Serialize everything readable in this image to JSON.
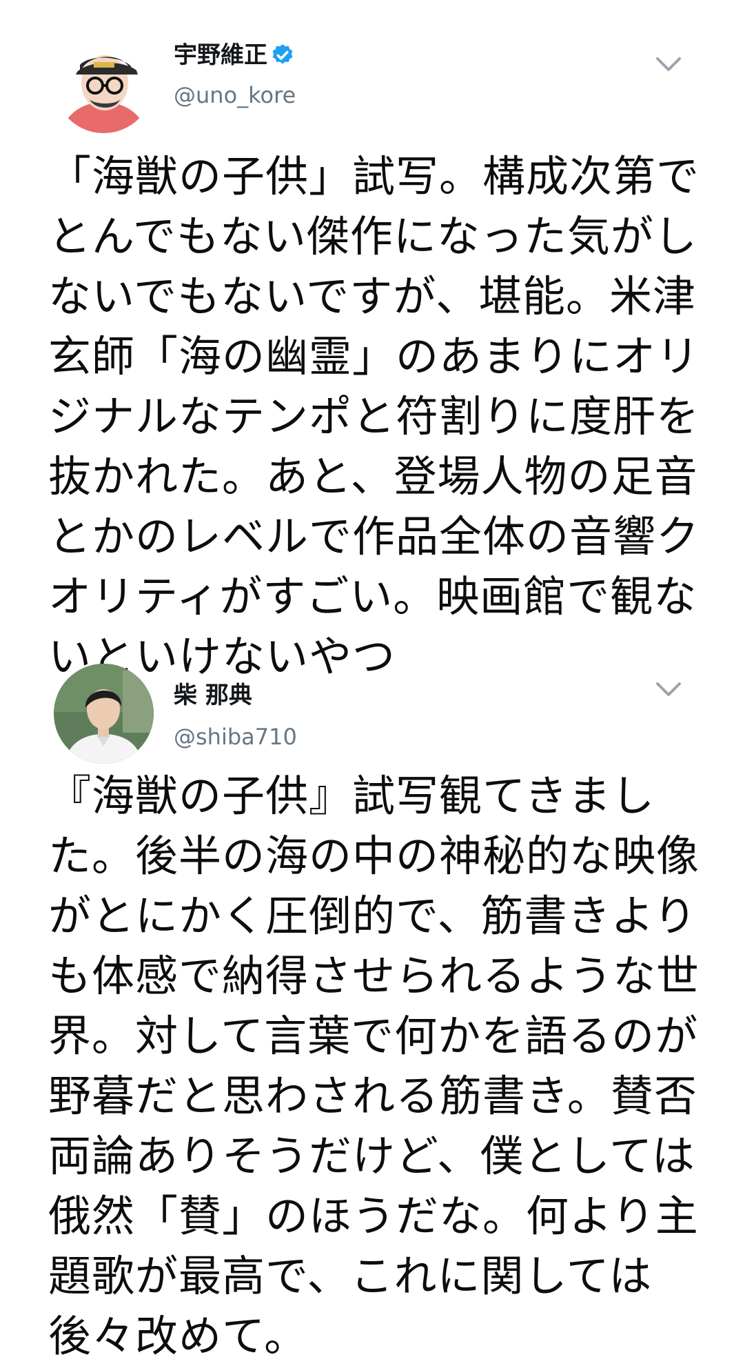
{
  "tweets": [
    {
      "author": {
        "display_name": "宇野維正",
        "verified": true,
        "handle": "@uno_kore",
        "avatar_icon": "avatar-illustration-cap-glasses"
      },
      "menu_icon": "chevron-down-icon",
      "text_lines": [
        "「海獣の子供」試写。構成次第で",
        "とんでもない傑作になった気がし",
        "ないでもないですが、堪能。米津",
        "玄師「海の幽霊」のあまりにオリ",
        "ジナルなテンポと符割りに度肝を",
        "抜かれた。あと、登場人物の足音",
        "とかのレベルで作品全体の音響ク",
        "オリティがすごい。映画館で観な",
        "いといけないやつ"
      ]
    },
    {
      "author": {
        "display_name": "柴 那典",
        "verified": false,
        "handle": "@shiba710",
        "avatar_icon": "avatar-photo-white-shirt"
      },
      "menu_icon": "chevron-down-icon",
      "text_lines": [
        "『海獣の子供』試写観てきまし",
        "た。後半の海の中の神秘的な映像",
        "がとにかく圧倒的で、筋書きより",
        "も体感で納得させられるような世",
        "界。対して言葉で何かを語るのが",
        "野暮だと思わされる筋書き。賛否",
        "両論ありそうだけど、僕としては",
        "俄然「賛」のほうだな。何より主",
        "題歌が最高で、これに関しては",
        "後々改めて。"
      ]
    }
  ],
  "colors": {
    "verified_blue": "#1da1f2",
    "handle_gray": "#657786",
    "caret_gray": "#9aa4ad"
  }
}
